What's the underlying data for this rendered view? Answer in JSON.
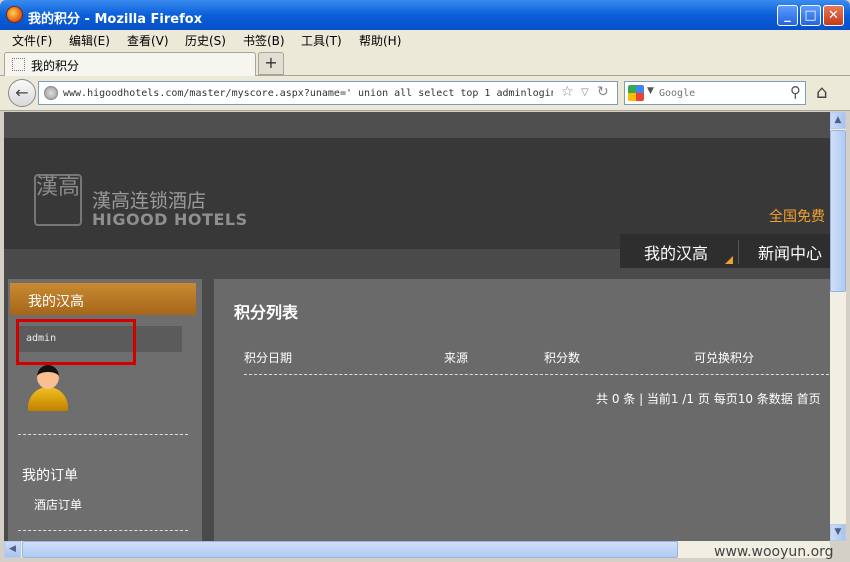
{
  "window": {
    "title": "我的积分 - Mozilla Firefox",
    "minimize": "_",
    "maximize": "□",
    "close": "✕"
  },
  "menu": [
    "文件(F)",
    "编辑(E)",
    "查看(V)",
    "历史(S)",
    "书签(B)",
    "工具(T)",
    "帮助(H)"
  ],
  "tab": {
    "label": "我的积分",
    "new_tab": "+"
  },
  "nav": {
    "url": "www.higoodhotels.com/master/myscore.aspx?uname=' union all select top 1 adminlogin",
    "search_placeholder": "Google"
  },
  "site": {
    "logo_mark": "漢高",
    "logo_cn": "漢高连锁酒店",
    "logo_en": "HIGOOD HOTELS",
    "hotline": "全国免费",
    "nav": [
      "我的汉高",
      "新闻中心"
    ]
  },
  "sidebar": {
    "header": "我的汉高",
    "username": "admin",
    "orders_heading": "我的订单",
    "hotel_orders": "酒店订单"
  },
  "main": {
    "title": "积分列表",
    "columns": [
      "积分日期",
      "来源",
      "积分数",
      "可兑换积分"
    ],
    "pager": "共 0 条 | 当前1 /1 页 每页10 条数据 首页"
  },
  "watermark": "www.wooyun.org",
  "icons": {
    "back": "back-arrow-icon",
    "reload": "reload-icon",
    "bookmark": "star-icon",
    "home": "home-icon",
    "search": "magnifier-icon"
  }
}
